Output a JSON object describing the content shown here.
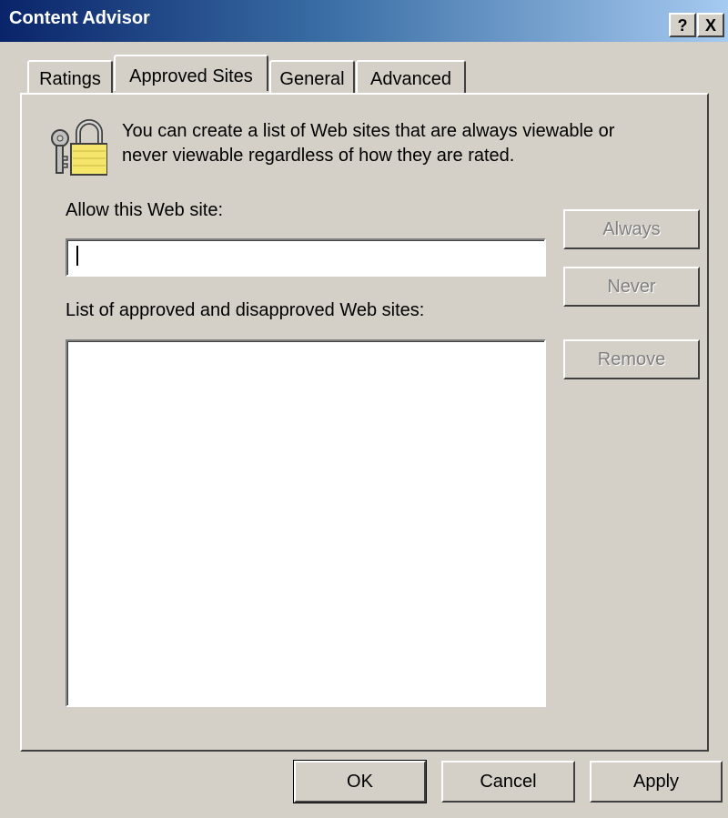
{
  "window": {
    "title": "Content Advisor",
    "help_button": "?",
    "close_button": "X"
  },
  "tabs": [
    {
      "label": "Ratings",
      "active": false
    },
    {
      "label": "Approved Sites",
      "active": true
    },
    {
      "label": "General",
      "active": false
    },
    {
      "label": "Advanced",
      "active": false
    }
  ],
  "approved_sites": {
    "description_line1": "You can create a list of Web sites that are always viewable or",
    "description_line2": "never viewable regardless of how they are rated.",
    "allow_label": "Allow this Web site:",
    "allow_input_value": "",
    "list_label": "List of approved and disapproved Web sites:",
    "list_items": [],
    "always_button": "Always",
    "never_button": "Never",
    "remove_button": "Remove",
    "icon": "lock-keys-icon"
  },
  "footer": {
    "ok_button": "OK",
    "cancel_button": "Cancel",
    "apply_button": "Apply"
  }
}
